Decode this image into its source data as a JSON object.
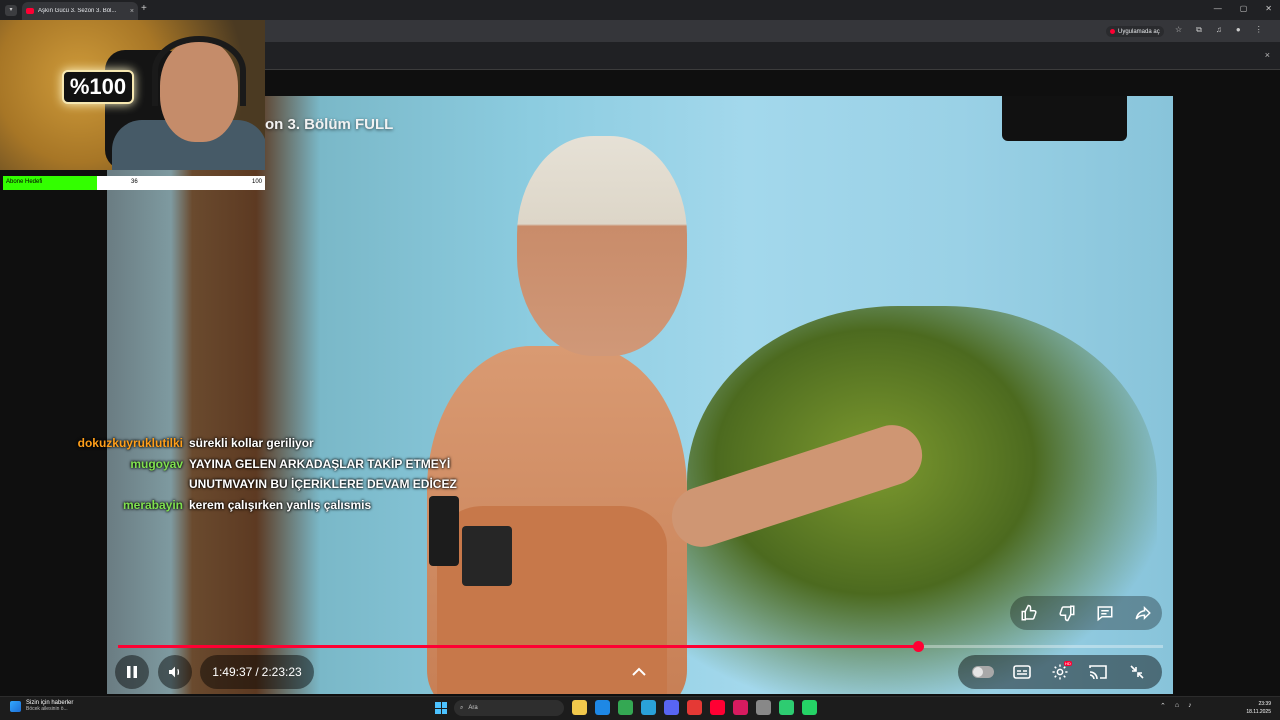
{
  "browser": {
    "tab_title": "Aşkın Gücü 3. Sezon 3. Böl...",
    "tab_close": "×",
    "new_tab": "+",
    "open_in_app": "Uygulamada aç",
    "window_controls": [
      "—",
      "▢",
      "✕"
    ],
    "infobar_close": "×"
  },
  "video": {
    "title_overlay": "on 3. Bölüm FULL",
    "current_time": "1:49:37",
    "separator": "/",
    "duration": "2:23:23",
    "progress_fraction": 0.766,
    "accent_color": "#ff0033"
  },
  "stream_goal": {
    "label": "Abone Hedefi",
    "current": "36",
    "target": "100",
    "fill_color": "#33ff00"
  },
  "chat": [
    {
      "user": "dokuzkuyruklutilki",
      "user_color": "#ff9f1a",
      "lines": [
        "sürekli kollar geriliyor"
      ]
    },
    {
      "user": "mugoyav",
      "user_color": "#7fe04f",
      "lines": [
        "YAYINA GELEN ARKADAŞLAR TAKİP ETMEYİ",
        "UNUTMVAYIN BU İÇERİKLERE DEVAM EDİCEZ"
      ]
    },
    {
      "user": "merabayin",
      "user_color": "#7fe04f",
      "lines": [
        "kerem çalışırken yanlış çalısmis"
      ]
    }
  ],
  "webcam": {
    "logo_text": "%100"
  },
  "taskbar": {
    "news_title": "Sizin için haberler",
    "news_sub": "Böcek ailesinin ö...",
    "search_placeholder": "Ara",
    "clock_time": "23:39",
    "clock_date": "18.11.2025",
    "app_colors": [
      "#f2c94c",
      "#1e88e5",
      "#34a853",
      "#2aa1d8",
      "#5865f2",
      "#e53935",
      "#ff0033",
      "#d81b60",
      "#888888",
      "#2ecc71",
      "#25d366"
    ]
  },
  "icons": {
    "pause": "pause-icon",
    "volume": "volume-icon",
    "chevron": "chevron-up-icon",
    "like": "thumbs-up-icon",
    "dislike": "thumbs-down-icon",
    "comment": "comment-icon",
    "share": "share-icon"
  }
}
